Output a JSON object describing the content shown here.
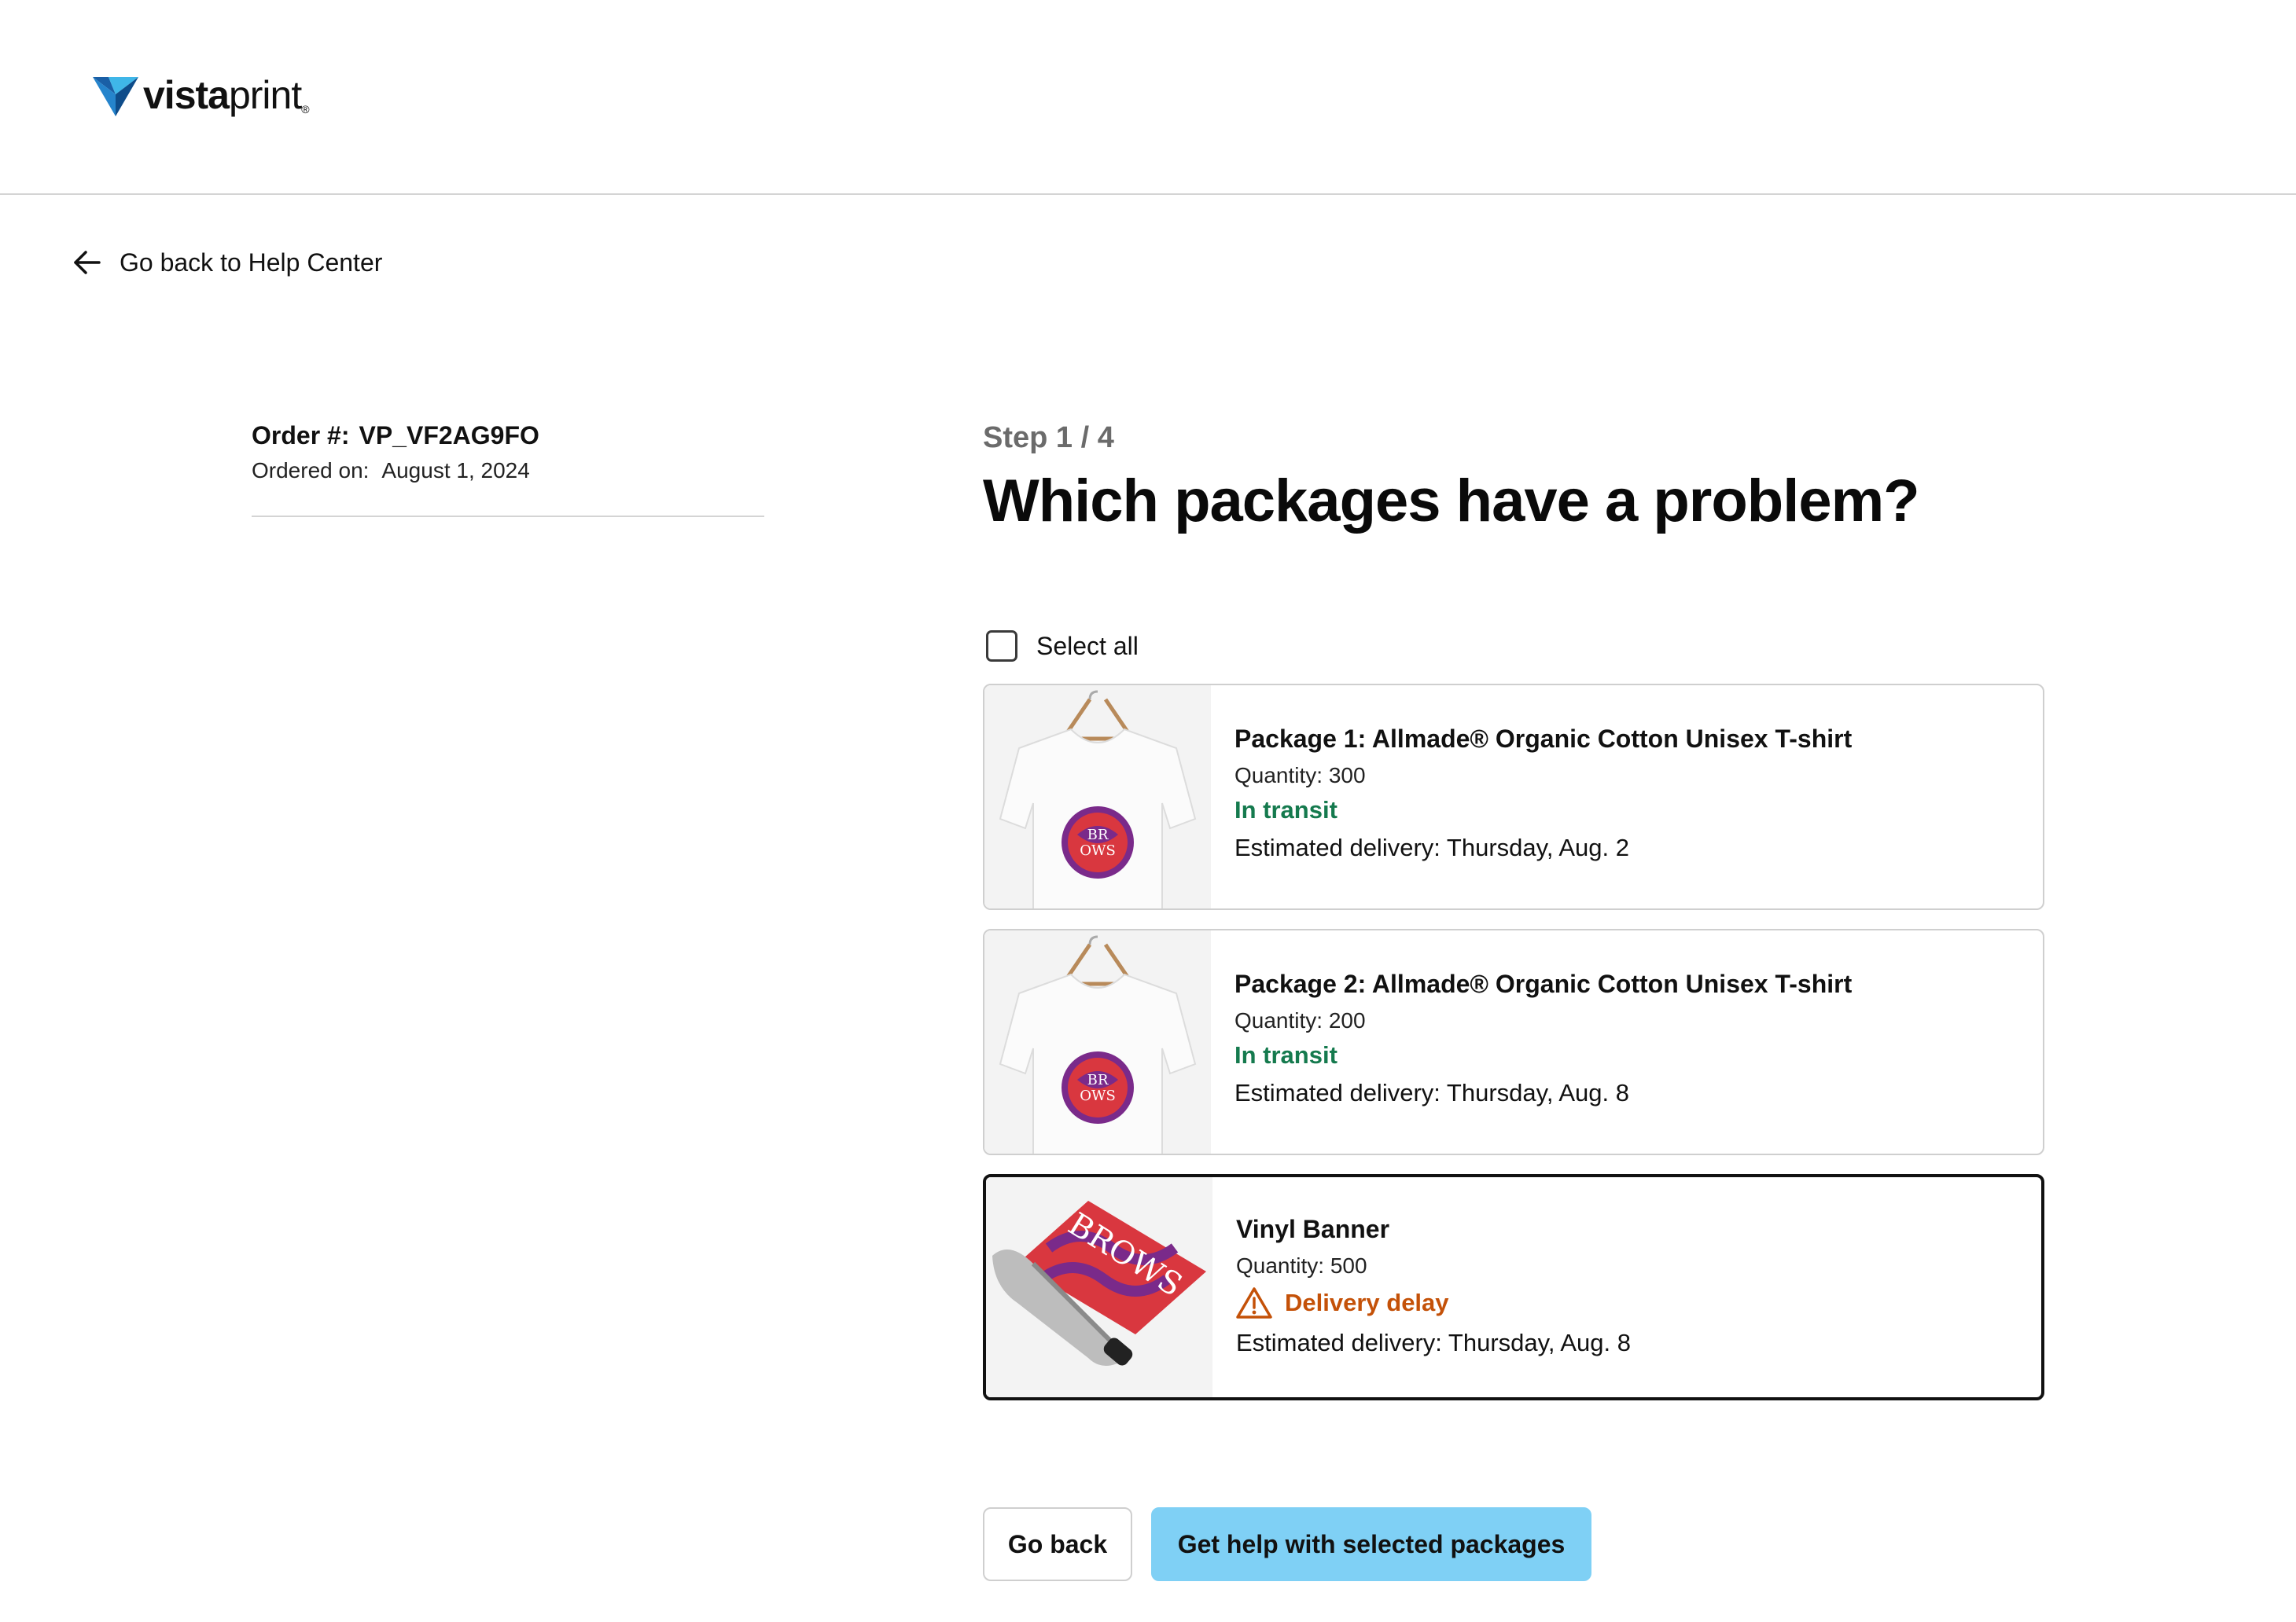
{
  "brand": {
    "name_bold": "vista",
    "name_light": "print",
    "reg": "®"
  },
  "nav": {
    "back_label": "Go back to Help Center"
  },
  "order": {
    "number_label": "Order #:",
    "number": "VP_VF2AG9FO",
    "date_label": "Ordered on:",
    "date": "August 1, 2024"
  },
  "wizard": {
    "step": "Step 1 / 4",
    "title": "Which packages have a problem?",
    "select_all": "Select all"
  },
  "packages": [
    {
      "name": "Package 1: Allmade® Organic Cotton Unisex T-shirt",
      "quantity": "Quantity: 300",
      "status": "In transit",
      "eta": "Estimated delivery: Thursday, Aug. 2",
      "image": "tshirt-image"
    },
    {
      "name": "Package 2: Allmade® Organic Cotton Unisex T-shirt",
      "quantity": "Quantity: 200",
      "status": "In transit",
      "eta": "Estimated delivery: Thursday, Aug. 8",
      "image": "tshirt-image"
    },
    {
      "name": "Vinyl Banner",
      "quantity": "Quantity: 500",
      "status": "Delivery delay",
      "eta": "Estimated delivery: Thursday, Aug. 8",
      "image": "vinyl-banner-image",
      "selected": true
    }
  ],
  "actions": {
    "back": "Go back",
    "help": "Get help with selected packages"
  },
  "colors": {
    "status_ok": "#157a4e",
    "status_warn": "#c45108",
    "primary_button": "#7fd0f5",
    "logo_blue_dark": "#1e6fb8",
    "logo_blue_light": "#3fb6e8"
  }
}
